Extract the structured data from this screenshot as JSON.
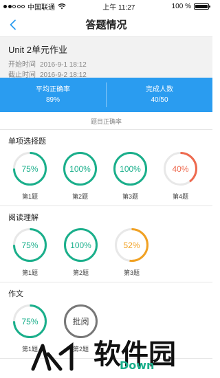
{
  "status_bar": {
    "carrier": "中国联通",
    "time": "上午 11:27",
    "battery": "100 %",
    "signal_bars": 2,
    "battery_level": 1.0
  },
  "nav": {
    "title": "答题情况",
    "back_icon": "chevron-left-icon"
  },
  "assignment": {
    "title": "Unit 2单元作业",
    "start_label": "开始时间",
    "start_time": "2016-9-1 18:12",
    "end_label": "截止时间",
    "end_time": "2016-9-2 18:12"
  },
  "summary": {
    "avg_label": "平均正确率",
    "avg_value": "89%",
    "done_label": "完成人数",
    "done_value": "40/50"
  },
  "hint": "题目正确率",
  "sections": [
    {
      "title": "单项选择题",
      "items": [
        {
          "label": "第1题",
          "value_text": "75%",
          "fraction": 0.75,
          "color": "#1aaf8b"
        },
        {
          "label": "第2题",
          "value_text": "100%",
          "fraction": 1.0,
          "color": "#1aaf8b"
        },
        {
          "label": "第3题",
          "value_text": "100%",
          "fraction": 1.0,
          "color": "#1aaf8b"
        },
        {
          "label": "第4题",
          "value_text": "40%",
          "fraction": 0.4,
          "color": "#ee6a4f"
        }
      ]
    },
    {
      "title": "阅读理解",
      "items": [
        {
          "label": "第1题",
          "value_text": "75%",
          "fraction": 0.75,
          "color": "#1aaf8b"
        },
        {
          "label": "第2题",
          "value_text": "100%",
          "fraction": 1.0,
          "color": "#1aaf8b"
        },
        {
          "label": "第3题",
          "value_text": "52%",
          "fraction": 0.52,
          "color": "#f1a122"
        }
      ]
    },
    {
      "title": "作文",
      "items": [
        {
          "label": "第1题",
          "value_text": "75%",
          "fraction": 0.75,
          "color": "#1aaf8b"
        },
        {
          "label": "第2题",
          "value_text": "批阅",
          "fraction": 0,
          "color": "#444444"
        }
      ]
    }
  ],
  "watermark": {
    "text": "软件园",
    "sub": "Down"
  },
  "colors": {
    "accent": "#2a9cf0",
    "ring_track": "#e8e8e8"
  }
}
